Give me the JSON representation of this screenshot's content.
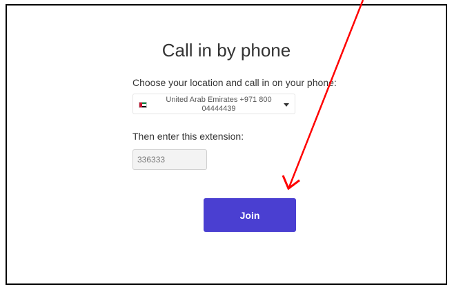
{
  "dialog": {
    "title": "Call in by phone",
    "location_label": "Choose your location and call in on your phone:",
    "location_select": {
      "country": "United Arab Emirates",
      "dial_code": "+971",
      "number": "800 04444439",
      "display_line1": "United Arab Emirates +971 800",
      "display_line2": "04444439",
      "flag_icon": "uae-flag-icon"
    },
    "extension_label": "Then enter this extension:",
    "extension_value": "336333",
    "join_label": "Join"
  },
  "colors": {
    "join_button": "#4a3fd1",
    "annotation_arrow": "#ff0000",
    "text": "#333333"
  }
}
